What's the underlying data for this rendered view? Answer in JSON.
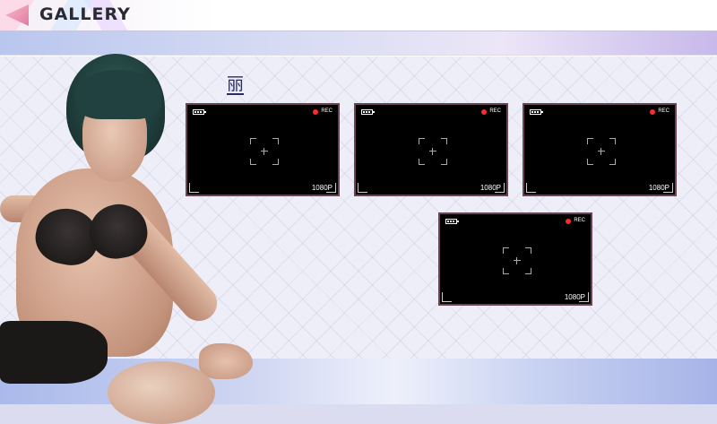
{
  "header": {
    "title": "GALLERY",
    "back_icon": "back-arrow-icon"
  },
  "character": {
    "label": "丽"
  },
  "thumbnails": [
    {
      "resolution": "1080P",
      "rec_label": "REC"
    },
    {
      "resolution": "1080P",
      "rec_label": "REC"
    },
    {
      "resolution": "1080P",
      "rec_label": "REC"
    },
    {
      "resolution": "1080P",
      "rec_label": "REC"
    }
  ],
  "colors": {
    "accent_pink": "#e07ca0",
    "frame": "#6a4357",
    "rec_red": "#ff2a2a",
    "label_blue": "#2a2b6b"
  }
}
